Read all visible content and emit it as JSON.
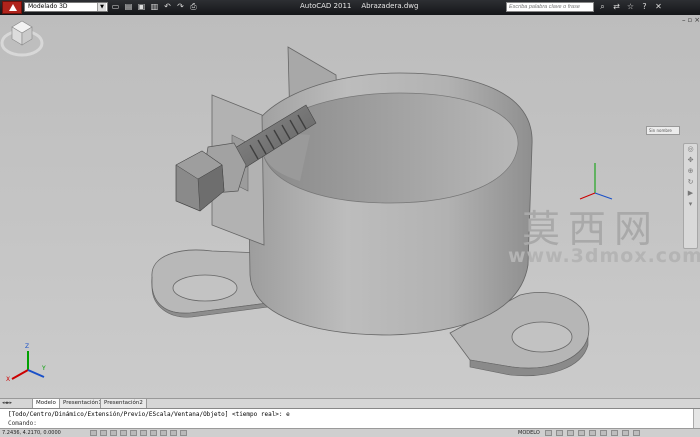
{
  "titlebar": {
    "workspace": "Modelado 3D",
    "app_name": "AutoCAD 2011",
    "file_name": "Abrazadera.dwg",
    "search_placeholder": "Escriba palabra clave o frase",
    "quick_access_icons": [
      "new-icon",
      "open-icon",
      "save-icon",
      "saveas-icon",
      "undo-icon",
      "redo-icon",
      "plot-icon"
    ],
    "help_icons": [
      "binoculars-icon",
      "exchange-icon",
      "star-icon",
      "help-icon"
    ]
  },
  "window_controls": [
    "minimize-icon",
    "restore-icon",
    "close-icon"
  ],
  "viewcube": {
    "label": "Sin nombre"
  },
  "navbar": {
    "icons": [
      "steering-wheel-icon",
      "pan-icon",
      "zoom-icon",
      "orbit-icon",
      "showmotion-icon",
      "dropdown-icon"
    ]
  },
  "watermark": {
    "chinese": "莫西网",
    "url": "www.3dmox.com"
  },
  "ucs": {
    "x": "X",
    "y": "Y",
    "z": "Z"
  },
  "tabs": [
    {
      "label": "Modelo"
    },
    {
      "label": "Presentación1"
    },
    {
      "label": "Presentación2"
    }
  ],
  "command": {
    "history": "[Todo/Centro/Dinámico/Extensión/Previo/EScala/Ventana/Objeto] <tiempo real>: e",
    "prompt": "Comando:"
  },
  "status": {
    "coordinates": "7.2436, 4.2170, 0.0000",
    "model_label": "MODELO"
  },
  "colors": {
    "titlebar": "#1c1d20",
    "viewport": "#c6c6c6",
    "clamp": "#a8a8a8"
  }
}
